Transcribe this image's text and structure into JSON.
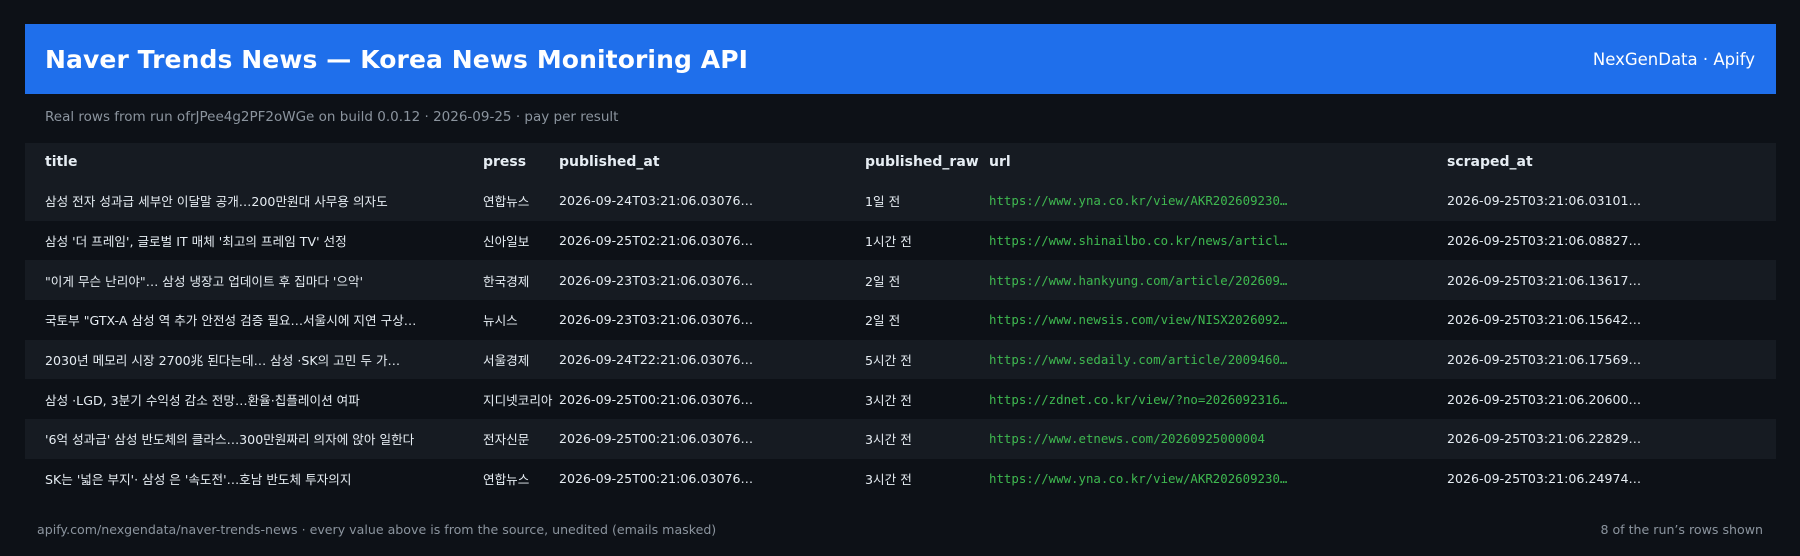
{
  "header": {
    "title": "Naver Trends News — Korea News Monitoring API",
    "brand": "NexGenData · Apify"
  },
  "subtitle": "Real rows from run ofrJPee4g2PF2oWGe on build 0.0.12 · 2026-09-25 · pay per result",
  "table": {
    "columns": [
      "title",
      "press",
      "published_at",
      "published_raw",
      "url",
      "scraped_at"
    ],
    "rows": [
      {
        "title": "삼성 전자 성과급 세부안 이달말 공개…200만원대 사무용 의자도",
        "press": "연합뉴스",
        "published_at": "2026-09-24T03:21:06.03076…",
        "published_raw": "1일 전",
        "url": "https://www.yna.co.kr/view/AKR202609230…",
        "scraped_at": "2026-09-25T03:21:06.03101…"
      },
      {
        "title": "삼성 '더 프레임', 글로벌 IT 매체 '최고의 프레임 TV' 선정",
        "press": "신아일보",
        "published_at": "2026-09-25T02:21:06.03076…",
        "published_raw": "1시간 전",
        "url": "https://www.shinailbo.co.kr/news/articl…",
        "scraped_at": "2026-09-25T03:21:06.08827…"
      },
      {
        "title": "\"이게 무슨 난리야\"… 삼성 냉장고 업데이트 후 집마다 '으악'",
        "press": "한국경제",
        "published_at": "2026-09-23T03:21:06.03076…",
        "published_raw": "2일 전",
        "url": "https://www.hankyung.com/article/202609…",
        "scraped_at": "2026-09-25T03:21:06.13617…"
      },
      {
        "title": "국토부 \"GTX-A 삼성 역 추가 안전성 검증 필요…서울시에 지연 구상…",
        "press": "뉴시스",
        "published_at": "2026-09-23T03:21:06.03076…",
        "published_raw": "2일 전",
        "url": "https://www.newsis.com/view/NISX2026092…",
        "scraped_at": "2026-09-25T03:21:06.15642…"
      },
      {
        "title": "2030년 메모리 시장 2700兆 된다는데… 삼성 ·SK의 고민 두 가…",
        "press": "서울경제",
        "published_at": "2026-09-24T22:21:06.03076…",
        "published_raw": "5시간 전",
        "url": "https://www.sedaily.com/article/2009460…",
        "scraped_at": "2026-09-25T03:21:06.17569…"
      },
      {
        "title": "삼성 ·LGD, 3분기 수익성 감소 전망…환율·칩플레이션 여파",
        "press": "지디넷코리아",
        "published_at": "2026-09-25T00:21:06.03076…",
        "published_raw": "3시간 전",
        "url": "https://zdnet.co.kr/view/?no=2026092316…",
        "scraped_at": "2026-09-25T03:21:06.20600…"
      },
      {
        "title": "'6억 성과급' 삼성 반도체의 클라스…300만원짜리 의자에 앉아 일한다",
        "press": "전자신문",
        "published_at": "2026-09-25T00:21:06.03076…",
        "published_raw": "3시간 전",
        "url": "https://www.etnews.com/20260925000004",
        "scraped_at": "2026-09-25T03:21:06.22829…"
      },
      {
        "title": "SK는 '넓은 부지'· 삼성 은 '속도전'…호남 반도체 투자의지",
        "press": "연합뉴스",
        "published_at": "2026-09-25T00:21:06.03076…",
        "published_raw": "3시간 전",
        "url": "https://www.yna.co.kr/view/AKR202609230…",
        "scraped_at": "2026-09-25T03:21:06.24974…"
      }
    ]
  },
  "footer": {
    "left": "apify.com/nexgendata/naver-trends-news  ·  every value above is from the source, unedited (emails masked)",
    "right": "8 of the run’s rows shown"
  },
  "colors": {
    "background": "#0d1117",
    "header": "#1f6feb",
    "row_alt": "#161b22",
    "url": "#3fb950",
    "muted": "#8b949e"
  }
}
